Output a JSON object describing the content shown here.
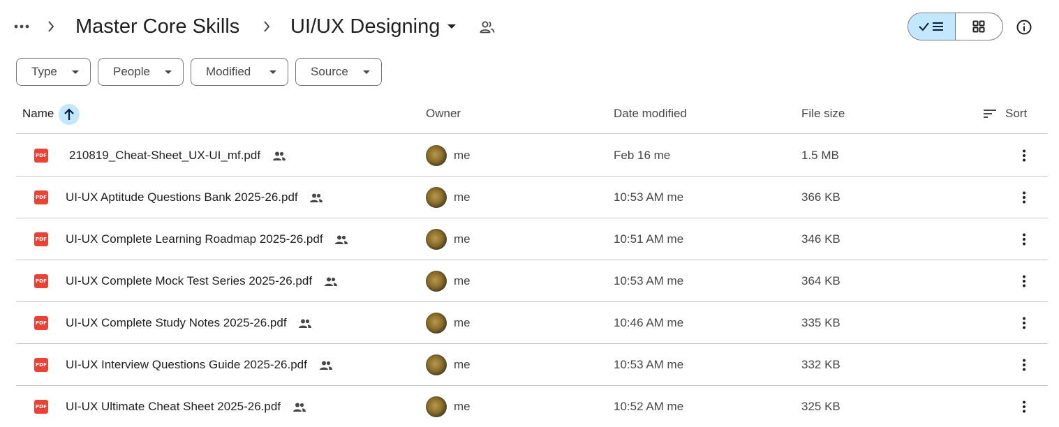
{
  "breadcrumb": {
    "parent": "Master Core Skills",
    "current": "UI/UX Designing"
  },
  "icons": {
    "more_crumbs": "more-horiz-icon",
    "separator": "chevron-right-icon",
    "shared_folder": "people-icon",
    "list_view": "list-view-icon",
    "grid_view": "grid-view-icon",
    "info": "info-icon",
    "file_type": "pdf-icon",
    "file_shared": "shared-people-icon",
    "row_menu": "more-vert-icon"
  },
  "filters": [
    {
      "label": "Type"
    },
    {
      "label": "People"
    },
    {
      "label": "Modified"
    },
    {
      "label": "Source"
    }
  ],
  "columns": {
    "name": "Name",
    "owner": "Owner",
    "date": "Date modified",
    "size": "File size",
    "sort": "Sort"
  },
  "pdf_badge": "PDF",
  "files": [
    {
      "name": "210819_Cheat-Sheet_UX-UI_mf.pdf",
      "owner": "me",
      "modified": "Feb 16 me",
      "size": "1.5 MB"
    },
    {
      "name": "UI-UX Aptitude Questions Bank 2025-26.pdf",
      "owner": "me",
      "modified": "10:53 AM me",
      "size": "366 KB"
    },
    {
      "name": "UI-UX Complete Learning Roadmap 2025-26.pdf",
      "owner": "me",
      "modified": "10:51 AM me",
      "size": "346 KB"
    },
    {
      "name": "UI-UX Complete Mock Test Series 2025-26.pdf",
      "owner": "me",
      "modified": "10:53 AM me",
      "size": "364 KB"
    },
    {
      "name": "UI-UX Complete Study Notes 2025-26.pdf",
      "owner": "me",
      "modified": "10:46 AM me",
      "size": "335 KB"
    },
    {
      "name": "UI-UX Interview Questions Guide 2025-26.pdf",
      "owner": "me",
      "modified": "10:53 AM me",
      "size": "332 KB"
    },
    {
      "name": "UI-UX Ultimate Cheat Sheet 2025-26.pdf",
      "owner": "me",
      "modified": "10:52 AM me",
      "size": "325 KB"
    }
  ],
  "colors": {
    "accent_bg": "#c2e7ff",
    "accent_fg": "#0b57d0",
    "pdf_red": "#ea4335",
    "border": "#747775",
    "divider": "#c4c7c5"
  }
}
